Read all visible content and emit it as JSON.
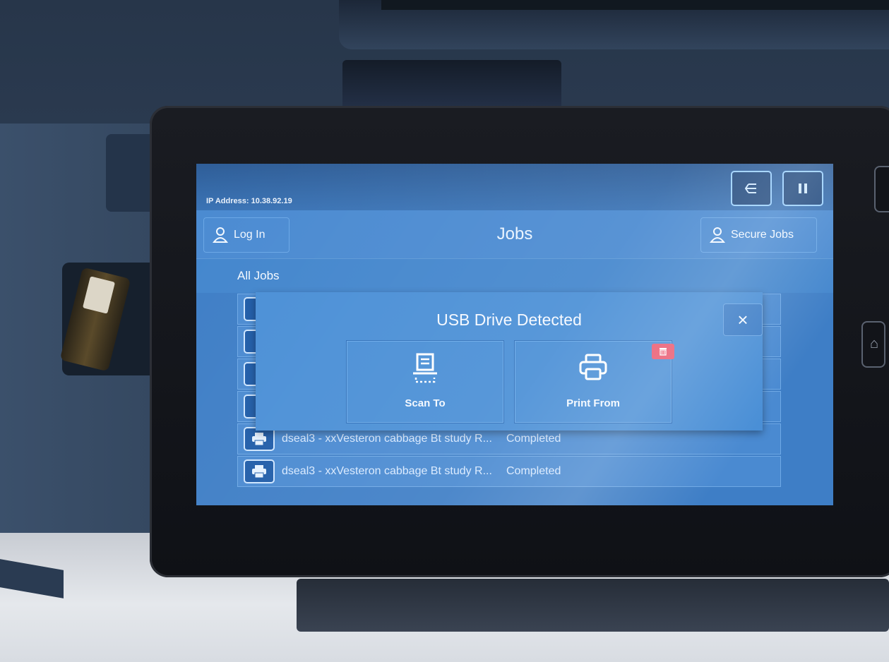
{
  "status_bar": {
    "ip_address": "IP Address: 10.38.92.19",
    "back_icon": "arrow-left-icon",
    "pause_icon": "pause-icon"
  },
  "header": {
    "login_label": "Log In",
    "title": "Jobs",
    "secure_jobs_label": "Secure Jobs"
  },
  "filter": {
    "label": "All Jobs"
  },
  "jobs": [
    {
      "name": "",
      "status": ""
    },
    {
      "name": "",
      "status": ""
    },
    {
      "name": "",
      "status": ""
    },
    {
      "name": "",
      "status": ""
    },
    {
      "name": "dseal3 - xxVesteron cabbage Bt study R...",
      "status": "Completed"
    },
    {
      "name": "dseal3 - xxVesteron cabbage Bt study R...",
      "status": "Completed"
    }
  ],
  "dialog": {
    "title": "USB Drive Detected",
    "close_label": "×",
    "options": [
      {
        "label": "Scan To",
        "icon": "scan-icon"
      },
      {
        "label": "Print From",
        "icon": "printer-icon"
      }
    ]
  },
  "colors": {
    "screen_blue": "#3e7ec6",
    "dialog_blue": "#4a8fd6",
    "delete_badge": "#e9586f"
  }
}
